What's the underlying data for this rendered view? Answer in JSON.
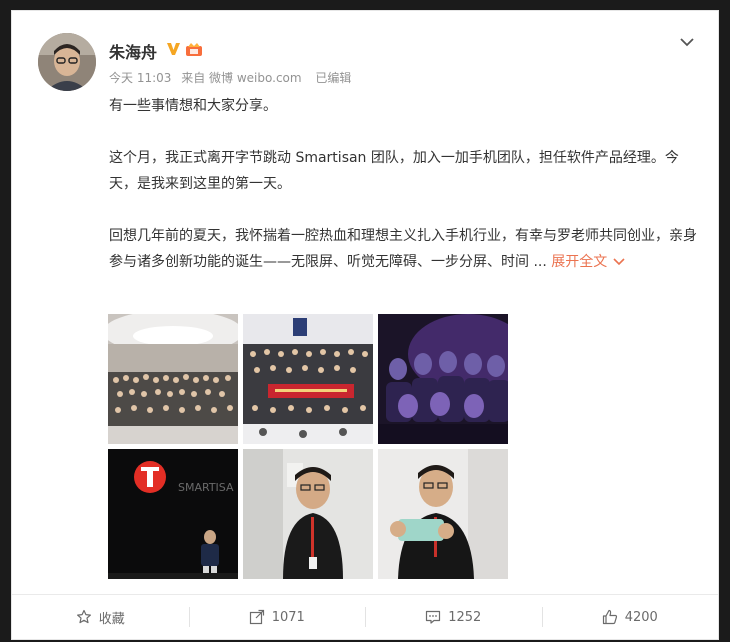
{
  "post": {
    "author": "朱海舟",
    "meta": {
      "time": "今天 11:03",
      "source": "来自 微博 weibo.com",
      "edited": "已编辑"
    },
    "paragraphs": [
      "有一些事情想和大家分享。",
      "这个月，我正式离开字节跳动 Smartisan 团队，加入一加手机团队，担任软件产品经理。今天，是我来到这里的第一天。",
      "回想几年前的夏天，我怀揣着一腔热血和理想主义扎入手机行业，有幸与罗老师共同创业，亲身参与诸多创新功能的诞生——无限屏、听觉无障碍、一步分屏、时间 ..."
    ],
    "expand_label": "展开全文",
    "images": [
      "group-photo-mall",
      "group-photo-banner",
      "audience-purple-light",
      "stage-speaker-smartisan",
      "portrait-office",
      "portrait-holding-phone"
    ],
    "logo_text": "SMARTISA"
  },
  "actions": {
    "favorite_label": "收藏",
    "repost_count": "1071",
    "comment_count": "1252",
    "like_count": "4200"
  },
  "colors": {
    "accent": "#eb7350",
    "verified": "#f5a623"
  }
}
